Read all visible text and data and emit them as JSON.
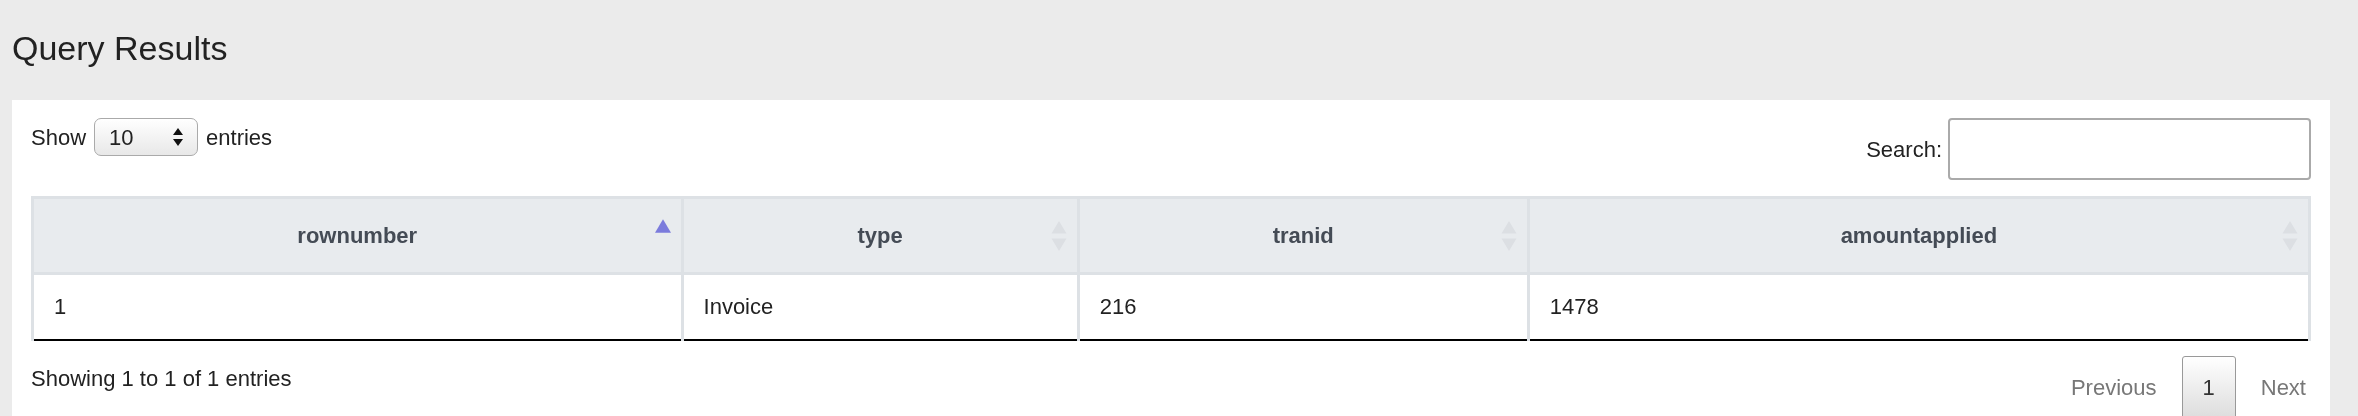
{
  "title": "Query Results",
  "length_menu": {
    "before": "Show",
    "value": "10",
    "after": "entries"
  },
  "search": {
    "label": "Search:"
  },
  "table": {
    "columns": [
      {
        "label": "rownumber",
        "sorted": true
      },
      {
        "label": "type",
        "sorted": false
      },
      {
        "label": "tranid",
        "sorted": false
      },
      {
        "label": "amountapplied",
        "sorted": false
      }
    ],
    "rows": [
      [
        "1",
        "Invoice",
        "216",
        "1478"
      ]
    ]
  },
  "info": "Showing 1 to 1 of 1 entries",
  "pagination": [
    {
      "label": "Previous",
      "kind": "nav",
      "disabled": true,
      "selected": false
    },
    {
      "label": "1",
      "kind": "page",
      "disabled": false,
      "selected": true
    },
    {
      "label": "Next",
      "kind": "nav",
      "disabled": true,
      "selected": false
    }
  ]
}
